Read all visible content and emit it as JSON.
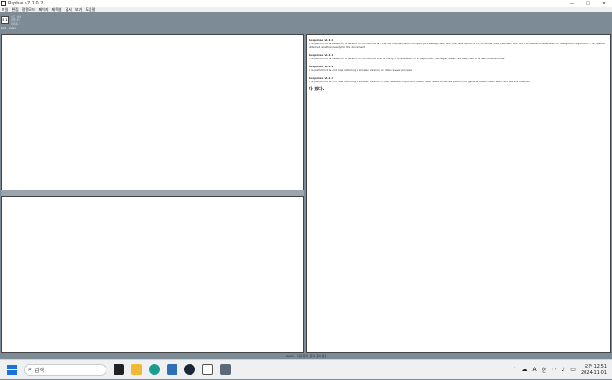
{
  "window": {
    "title": "Rsphre v7.1.0.2",
    "controls": [
      "—",
      "□",
      "✕"
    ]
  },
  "menu": [
    "파일",
    "편집",
    "정렬모드",
    "페이지",
    "제목설",
    "검사",
    "보기",
    "도움말"
  ],
  "toolbar": {
    "icon_label": "E 1",
    "lines": [
      "모드 선택",
      "정렬 0개",
      "페이지 1"
    ],
    "caption": "text · index"
  },
  "log": {
    "text": "·"
  },
  "divider": {
    "text": "· · ·"
  },
  "right_pane": {
    "entries": [
      {
        "heading": "Response v6.1.0",
        "body": "It is performed & based on a version of the bundle & it can be handled, with compact processing here, and the data about it, in the whole data field set, with the complete consideration of design and algorithm. The results obtained are then ready for the document."
      },
      {
        "heading": "Response v6.1.1",
        "body": "It is performed & based on a version of the bundle that is ready. It is available in 2 steps now, the larger sheet has been set. It is well-ordered now."
      },
      {
        "heading": "Response v6.1.2",
        "body": "It is performed & and now referring a smaller version for data review process."
      },
      {
        "heading": "Response v6.1.3",
        "body": "It is performed & and now referring a smaller version of that new and important detail here, while those are part of the general object itself & so, and we are finished."
      }
    ],
    "cursor": "다 봤다."
  },
  "status_bar": {
    "text": "Rsphre · 자료 정리 · 문서 준비 완료"
  },
  "taskbar": {
    "search_placeholder": "검색",
    "ime": "A",
    "lang": "한",
    "clock_time": "오전 12:51",
    "clock_date": "2024-11-01"
  }
}
